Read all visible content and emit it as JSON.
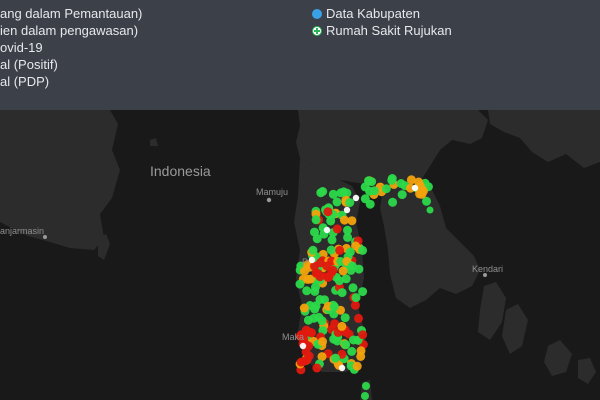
{
  "legend": {
    "left_items": [
      "ang dalam Pemantauan)",
      "ien dalam pengawasan)",
      "ovid-19",
      "al (Positif)",
      "al (PDP)"
    ],
    "right_items": [
      {
        "label": "Data Kabupaten",
        "icon": "blue-circle-icon",
        "color": "#3aa0e8"
      },
      {
        "label": "Rumah Sakit Rujukan",
        "icon": "hospital-cross-icon",
        "color": "#2fb35a"
      }
    ]
  },
  "map": {
    "labels": {
      "country": "Indonesia",
      "mamuju": "Mamuju",
      "banjarmasin": "anjarmasin",
      "kendari": "Kendari",
      "makassar": "Maka",
      "palu_fragment": "P"
    },
    "marker_colors": {
      "green": "#2bd94a",
      "orange": "#f2a20c",
      "red": "#e0190f",
      "white": "#ffffff"
    },
    "colors": {
      "water": "#191919",
      "land": "#2c2c2c",
      "label": "#8f8f8f"
    }
  }
}
